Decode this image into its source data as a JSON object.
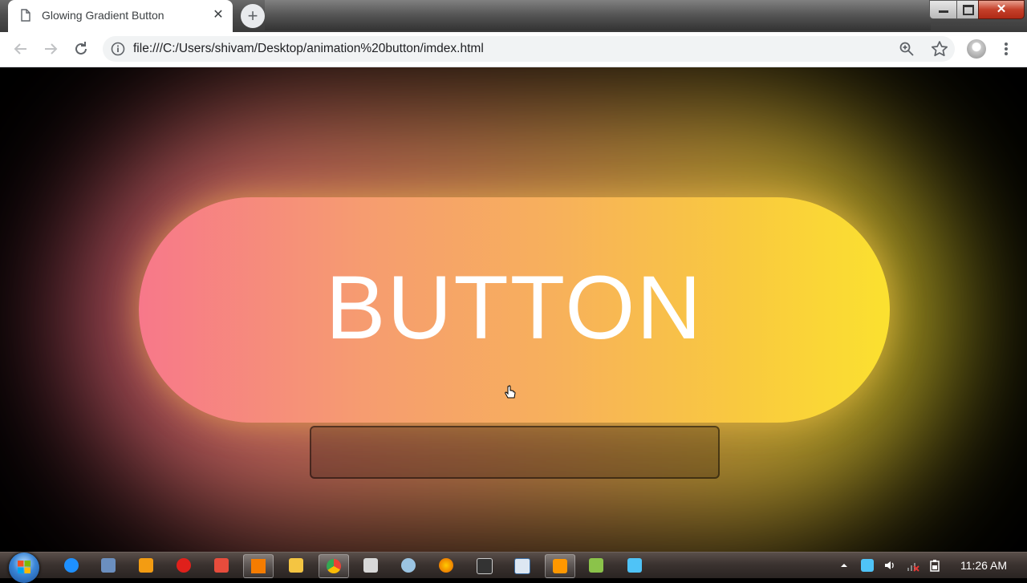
{
  "browser": {
    "tab_title": "Glowing Gradient Button",
    "tab_close": "✕",
    "new_tab": "+",
    "address_url": "file:///C:/Users/shivam/Desktop/animation%20button/imdex.html",
    "window_close": "✕"
  },
  "page": {
    "button_label": "BUTTON",
    "gradient_colors": [
      "#f7788a",
      "#f7b05c",
      "#fbe12f"
    ],
    "background_color": "#000000"
  },
  "taskbar": {
    "pinned_icons": [
      "internet-explorer-icon",
      "media-player-icon",
      "photo-app-icon",
      "opera-icon",
      "record-app-icon",
      "vlc-icon",
      "file-explorer-icon",
      "chrome-icon",
      "calculator-icon",
      "paint-icon",
      "firefox-icon",
      "app-icon",
      "notepad-icon",
      "sublime-text-icon",
      "notepad-plus-plus-icon",
      "camera-app-icon"
    ],
    "clock": "11:26 AM"
  }
}
